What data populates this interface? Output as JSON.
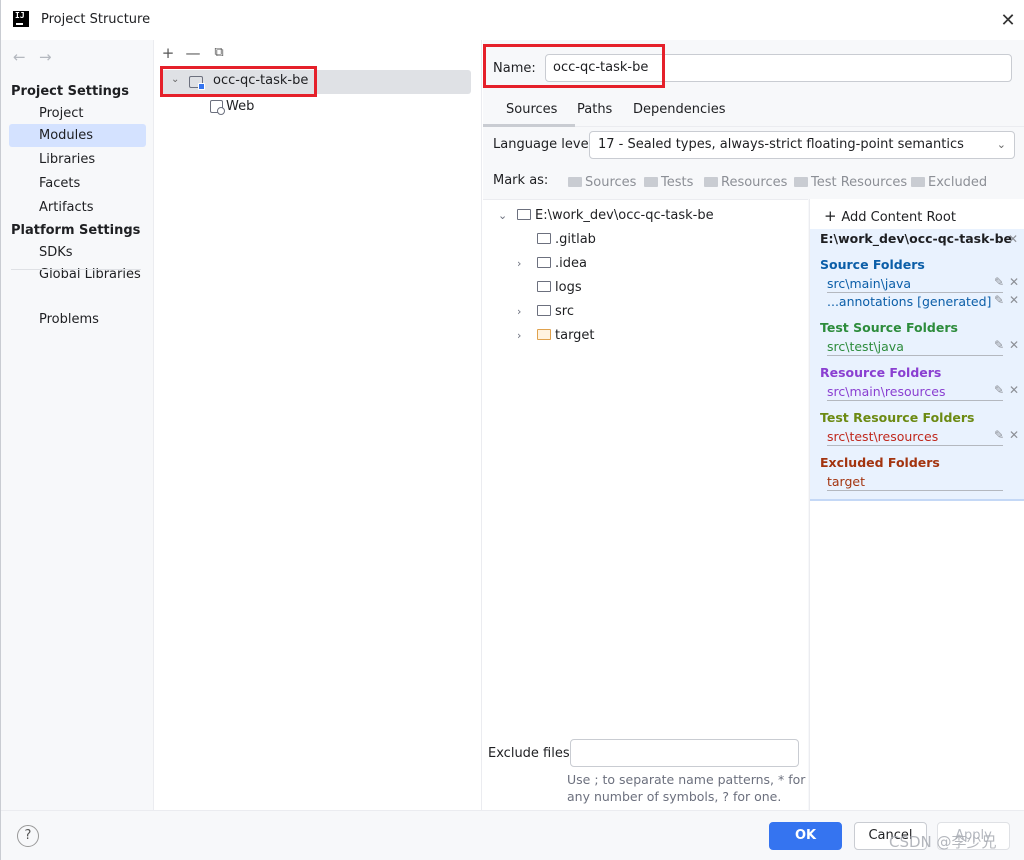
{
  "window": {
    "title": "Project Structure",
    "close_glyph": "✕"
  },
  "sidebar": {
    "back": "←",
    "forward": "→",
    "project_settings_header": "Project Settings",
    "project_settings_items": [
      "Project",
      "Modules",
      "Libraries",
      "Facets",
      "Artifacts"
    ],
    "platform_settings_header": "Platform Settings",
    "platform_settings_items": [
      "SDKs",
      "Global Libraries"
    ],
    "problems": "Problems",
    "selected": "Modules"
  },
  "modules_tree": {
    "toolbar": {
      "add": "+",
      "remove": "—",
      "copy": "⧉"
    },
    "module_name": "occ-qc-task-be",
    "children": [
      "Web"
    ]
  },
  "module": {
    "name_label": "Name:",
    "name_value": "occ-qc-task-be",
    "tabs": [
      "Sources",
      "Paths",
      "Dependencies"
    ],
    "active_tab": "Sources",
    "language_level_label": "Language level:",
    "language_level_value": "17 - Sealed types, always-strict floating-point semantics",
    "mark_as_label": "Mark as:",
    "mark_as_options": [
      "Sources",
      "Tests",
      "Resources",
      "Test Resources",
      "Excluded"
    ]
  },
  "file_tree": {
    "root": "E:\\work_dev\\occ-qc-task-be",
    "items": [
      ".gitlab",
      ".idea",
      "logs",
      "src",
      "target"
    ]
  },
  "content_root": {
    "add_label": "Add Content Root",
    "path": "E:\\work_dev\\occ-qc-task-be",
    "source_folders_title": "Source Folders",
    "source_folders": [
      "src\\main\\java",
      "...annotations [generated]"
    ],
    "test_source_folders_title": "Test Source Folders",
    "test_source_folders": [
      "src\\test\\java"
    ],
    "resource_folders_title": "Resource Folders",
    "resource_folders": [
      "src\\main\\resources"
    ],
    "test_resource_folders_title": "Test Resource Folders",
    "test_resource_folders": [
      "src\\test\\resources"
    ],
    "excluded_folders_title": "Excluded Folders",
    "excluded_folders": [
      "target"
    ],
    "colors": {
      "source": "#0b5ea8",
      "test": "#2d8c3c",
      "resource": "#8a3fd1",
      "test_resource": "#6c8a13",
      "excluded": "#a3340f"
    }
  },
  "exclude": {
    "label": "Exclude files:",
    "hint": "Use ; to separate name patterns, * for any number of symbols, ? for one."
  },
  "buttons": {
    "help": "?",
    "ok": "OK",
    "cancel": "Cancel",
    "apply": "Apply"
  },
  "watermark": "CSDN @李少兄"
}
